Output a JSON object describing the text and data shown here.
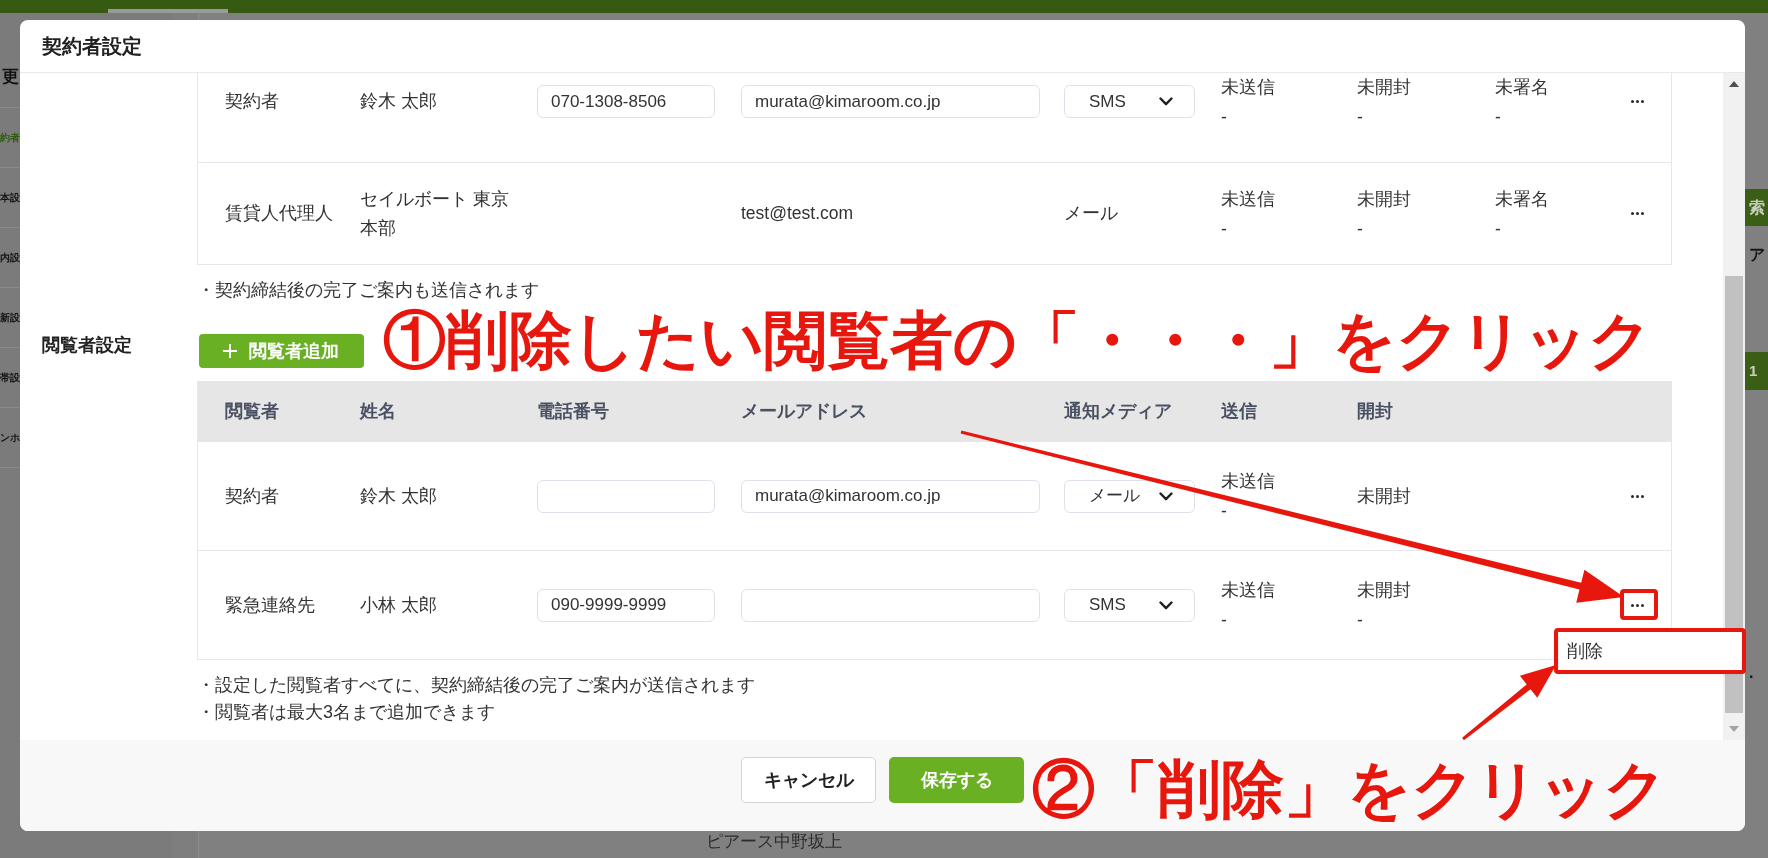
{
  "background_page": {
    "title_fragment": "更",
    "sidebar": [
      {
        "label": "約者",
        "selected": true
      },
      {
        "label": "本設",
        "selected": false
      },
      {
        "label": "内設",
        "selected": false
      },
      {
        "label": "新設",
        "selected": false
      },
      {
        "label": "帯設",
        "selected": false
      },
      {
        "label": "ンホ",
        "selected": false
      }
    ],
    "right_edge": [
      {
        "kind": "button",
        "label": "索"
      },
      {
        "kind": "text",
        "label": "ア"
      },
      {
        "kind": "badge",
        "label": "1"
      },
      {
        "kind": "text",
        "label": "."
      }
    ],
    "footer_text": "ピアース中野坂上"
  },
  "modal": {
    "title": "契約者設定",
    "signers": {
      "rows": [
        {
          "role": "契約者",
          "name": "鈴木 太郎",
          "phone": {
            "kind": "input",
            "value": "070-1308-8506"
          },
          "email": {
            "kind": "input",
            "value": "murata@kimaroom.co.jp"
          },
          "media": {
            "kind": "select",
            "value": "SMS"
          },
          "statuses": [
            {
              "label": "未送信",
              "detail": "-"
            },
            {
              "label": "未開封",
              "detail": "-"
            },
            {
              "label": "未署名",
              "detail": "-"
            }
          ],
          "menu_open": false
        },
        {
          "role": "賃貸人代理人",
          "name": "セイルボート 東京本部",
          "email": {
            "kind": "text",
            "value": "test@test.com"
          },
          "media": {
            "kind": "text",
            "value": "メール"
          },
          "statuses": [
            {
              "label": "未送信",
              "detail": "-"
            },
            {
              "label": "未開封",
              "detail": "-"
            },
            {
              "label": "未署名",
              "detail": "-"
            }
          ],
          "menu_open": false
        }
      ],
      "note": "・契約締結後の完了ご案内も送信されます"
    },
    "viewers": {
      "label": "閲覧者設定",
      "add_button": "閲覧者追加",
      "columns": [
        "閲覧者",
        "姓名",
        "電話番号",
        "メールアドレス",
        "通知メディア",
        "送信",
        "開封"
      ],
      "rows": [
        {
          "role": "契約者",
          "name": "鈴木 太郎",
          "phone": {
            "kind": "input"
          },
          "email": {
            "kind": "input",
            "value": "murata@kimaroom.co.jp"
          },
          "media": {
            "kind": "select",
            "value": "メール"
          },
          "statuses": [
            {
              "label": "未送信",
              "detail": "-"
            },
            {
              "label": "未開封"
            }
          ],
          "menu_open": false
        },
        {
          "role": "緊急連絡先",
          "name": "小林 太郎",
          "phone": {
            "kind": "input",
            "value": "090-9999-9999"
          },
          "email": {
            "kind": "input"
          },
          "media": {
            "kind": "select",
            "value": "SMS"
          },
          "statuses": [
            {
              "label": "未送信",
              "detail": "-"
            },
            {
              "label": "未開封",
              "detail": "-"
            }
          ],
          "menu_open": true,
          "menu_items": [
            "削除"
          ]
        }
      ],
      "notes": [
        "・設定した閲覧者すべてに、契約締結後の完了ご案内が送信されます",
        "・閲覧者は最大3名まで追加できます"
      ]
    },
    "footer": {
      "buttons": [
        {
          "label": "キャンセル",
          "kind": "secondary"
        },
        {
          "label": "保存する",
          "kind": "primary"
        }
      ]
    }
  },
  "annotations": [
    {
      "kind": "callout",
      "text": "①削除したい閲覧者の「・・・」をクリック"
    },
    {
      "kind": "callout",
      "text": "②「削除」をクリック"
    }
  ]
}
